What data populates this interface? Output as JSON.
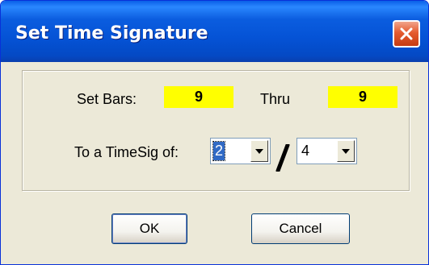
{
  "window": {
    "title": "Set Time Signature"
  },
  "bars": {
    "label": "Set Bars:",
    "from_value": "9",
    "thru_label": "Thru",
    "thru_value": "9"
  },
  "timesig": {
    "label": "To a TimeSig of:",
    "numerator": "2",
    "separator": "/",
    "denominator": "4"
  },
  "buttons": {
    "ok": "OK",
    "cancel": "Cancel"
  },
  "icons": {
    "close": "close-icon",
    "dropdown": "chevron-down-icon"
  },
  "colors": {
    "highlight": "#ffff00",
    "titlebar": "#0553d6",
    "close_button": "#e55b2f"
  }
}
